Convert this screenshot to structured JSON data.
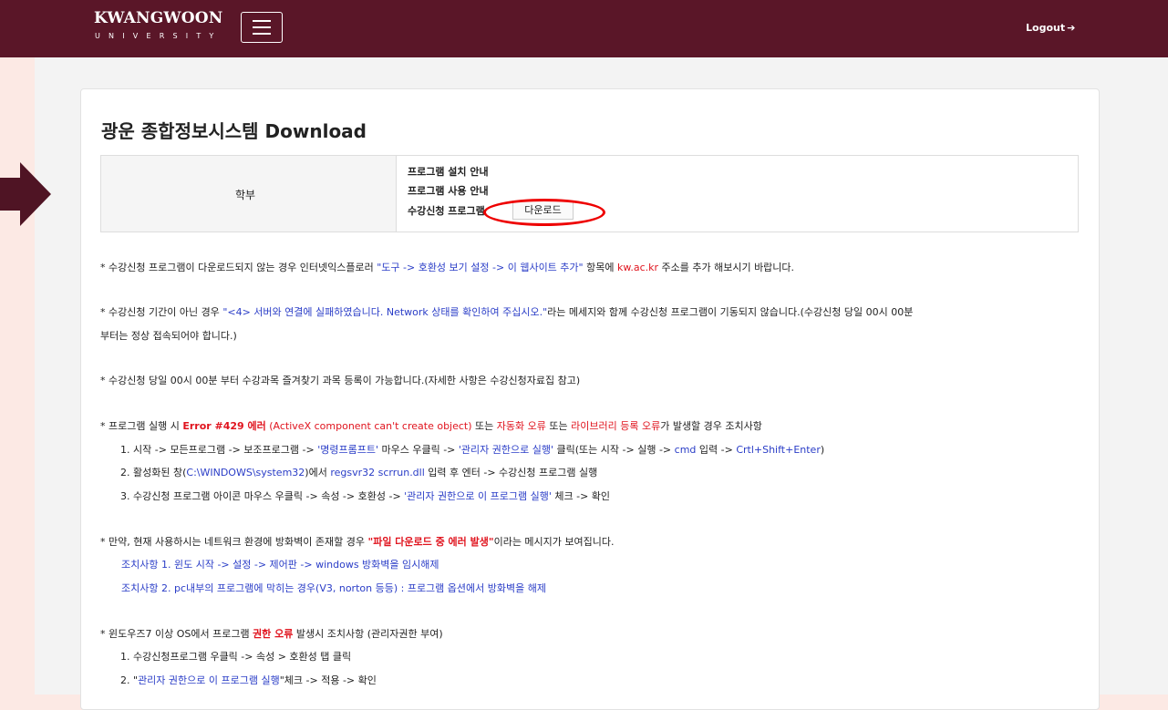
{
  "header": {
    "logo_main": "KWANGWOON",
    "logo_sub": "UNIVERSITY",
    "logout_label": "Logout"
  },
  "page": {
    "title": "광운 종합정보시스템 Download",
    "download": {
      "category": "학부",
      "lines": [
        "프로그램 설치 안내",
        "프로그램 사용 안내",
        "수강신청 프로그램"
      ],
      "button_label": "다운로드"
    }
  },
  "notices": {
    "n1": {
      "a": "* 수강신청 프로그램이 다운로드되지 않는 경우 인터넷익스플로러 ",
      "b": "\"도구 -> 호환성 보기 설정 -> 이 웹사이트 추가\"",
      "c": " 항목에 ",
      "d": "kw.ac.kr",
      "e": " 주소를 추가 해보시기 바랍니다."
    },
    "n2": {
      "a": "* 수강신청 기간이 아닌 경우 ",
      "b": "\"<4> 서버와 연결에 실패하였습니다. Network 상태를 확인하여 주십시오.\"",
      "c": "라는 메세지와 함께 수강신청 프로그램이 기동되지 않습니다.(수강신청 당일 00시 00분",
      "d": "부터는 정상 접속되어야 합니다.)"
    },
    "n3": "* 수강신청 당일 00시 00분 부터 수강과목 즐겨찾기 과목 등록이 가능합니다.(자세한 사항은 수강신청자료집 참고)",
    "n4": {
      "a": "* 프로그램 실행 시 ",
      "b": "Error #429 에러",
      "c": " (ActiveX component can't create object)",
      "d": " 또는 ",
      "e": "자동화 오류",
      "f": " 또는 ",
      "g": "라이브러리 등록 오류",
      "h": "가 발생할 경우 조치사항",
      "s1": {
        "a": "1. 시작 -> 모든프로그램 -> 보조프로그램 -> ",
        "b": "'명령프롬프트'",
        "c": " 마우스 우클릭 -> ",
        "d": "'관리자 권한으로 실행'",
        "e": " 클릭(또는 시작 -> 실행 -> ",
        "f": "cmd",
        "g": " 입력 -> ",
        "h": "Crtl+Shift+Enter",
        "i": ")"
      },
      "s2": {
        "a": "2. 활성화된 창(",
        "b": "C:\\WINDOWS\\system32",
        "c": ")에서 ",
        "d": "regsvr32 scrrun.dll",
        "e": " 입력 후 엔터 -> 수강신청 프로그램 실행"
      },
      "s3": {
        "a": "3. 수강신청 프로그램 아이콘 마우스 우클릭 -> 속성 -> 호환성 -> ",
        "b": "'관리자 권한으로 이 프로그램 실행'",
        "c": " 체크 -> 확인"
      }
    },
    "n5": {
      "a": "* 만약, 현재 사용하시는 네트워크 환경에 방화벽이 존재할 경우 ",
      "b": "\"파일 다운로드 중 에러 발생\"",
      "c": "이라는 메시지가 보여집니다.",
      "s1": "조치사항 1. 윈도 시작 -> 설정 -> 제어판 -> windows 방화벽을 임시해제",
      "s2": "조치사항 2. pc내부의 프로그램에 막히는 경우(V3, norton 등등) : 프로그램 옵션에서 방화벽을 해제"
    },
    "n6": {
      "a": "* 윈도우즈7 이상 OS에서 프로그램 ",
      "b": "권한 오류",
      "c": " 발생시 조치사항 (관리자권한 부여)",
      "s1": "1. 수강신청프로그램 우클릭 -> 속성 > 호환성 탭 클릭",
      "s2": {
        "a": "2. \"",
        "b": "관리자 권한으로 이 프로그램 실행",
        "c": "\"체크 -> 적용 -> 확인"
      }
    }
  },
  "colors": {
    "header_bg": "#5a1628",
    "link_blue": "#2a3dc7",
    "error_red": "#e0141e",
    "side_bg": "#fce9e4"
  }
}
